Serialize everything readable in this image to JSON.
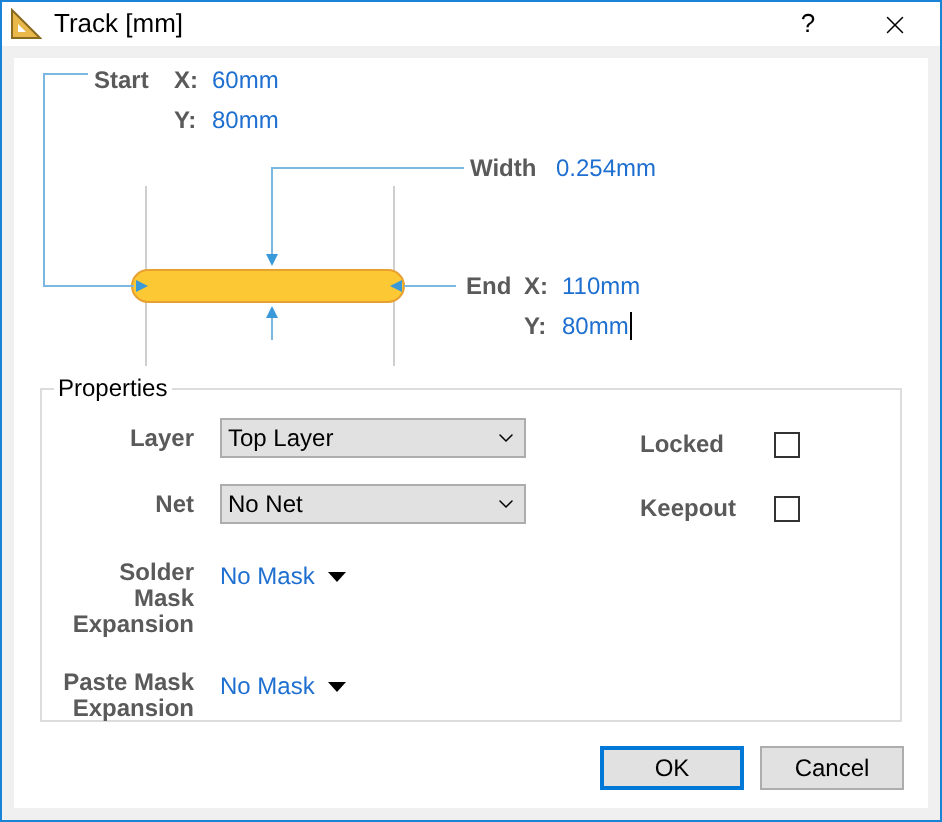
{
  "window": {
    "title": "Track [mm]",
    "help": "?"
  },
  "diagram": {
    "start": {
      "label": "Start",
      "x_label": "X:",
      "x": "60mm",
      "y_label": "Y:",
      "y": "80mm",
      "editing": false
    },
    "width": {
      "label": "Width",
      "value": "0.254mm"
    },
    "end": {
      "label": "End",
      "x_label": "X:",
      "x": "110mm",
      "y_label": "Y:",
      "y": "80mm",
      "editing": true
    }
  },
  "properties": {
    "title": "Properties",
    "fields": [
      {
        "kind": "dropdown",
        "label": "Layer",
        "value": "Top Layer"
      },
      {
        "kind": "dropdown",
        "label": "Net",
        "value": "No Net"
      },
      {
        "kind": "menu",
        "label": "Solder Mask Expansion",
        "value": "No Mask"
      },
      {
        "kind": "menu",
        "label": "Paste Mask Expansion",
        "value": "No Mask"
      }
    ],
    "checkboxes": [
      {
        "label": "Locked",
        "checked": false
      },
      {
        "label": "Keepout",
        "checked": false
      }
    ]
  },
  "buttons": [
    {
      "label": "OK",
      "default": true
    },
    {
      "label": "Cancel",
      "default": false
    }
  ]
}
